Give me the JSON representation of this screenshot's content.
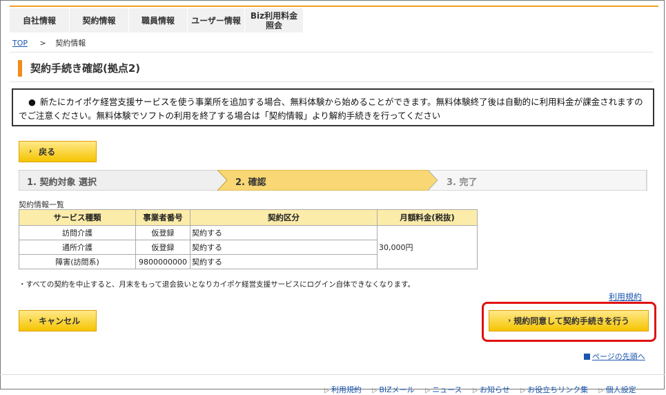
{
  "nav": [
    {
      "label": "自社情報"
    },
    {
      "label": "契約情報"
    },
    {
      "label": "職員情報"
    },
    {
      "label": "ユーザー情報"
    },
    {
      "label": "Biz利用料金\n照会"
    }
  ],
  "breadcrumb": {
    "top": "TOP",
    "separator": ">",
    "current": "契約情報"
  },
  "page_title": "契約手続き確認(拠点2)",
  "notice": "新たにカイポケ経営支援サービスを使う事業所を追加する場合、無料体験から始めることができます。無料体験終了後は自動的に利用料金が課金されますのでご注意ください。無料体験でソフトの利用を終了する場合は「契約情報」より解約手続きを行ってください",
  "back_button": "戻る",
  "steps": [
    {
      "label": "1. 契約対象 選択",
      "state": "done"
    },
    {
      "label": "2. 確認",
      "state": "active"
    },
    {
      "label": "3. 完了",
      "state": "pending"
    }
  ],
  "table": {
    "caption": "契約情報一覧",
    "headers": [
      "サービス種類",
      "事業者番号",
      "契約区分",
      "月額料金(税抜)"
    ],
    "rows": [
      {
        "service": "訪問介護",
        "number": "仮登録",
        "type": "契約する"
      },
      {
        "service": "通所介護",
        "number": "仮登録",
        "type": "契約する"
      },
      {
        "service": "障害(訪問系)",
        "number": "9800000000",
        "type": "契約する"
      }
    ],
    "monthly_fee": "30,000円"
  },
  "note": "・すべての契約を中止すると、月末をもって退会扱いとなりカイポケ経営支援サービスにログイン自体できなくなります。",
  "terms_link": "利用規約",
  "cancel_button": "キャンセル",
  "agree_button": "規約同意して契約手続きを行う",
  "page_top_link": "ページの先頭へ",
  "footer_links": [
    "利用規約",
    "BIZメール",
    "ニュース",
    "お知らせ",
    "お役立ちリンク集",
    "個人設定"
  ],
  "colors": {
    "accent": "#f08c1a",
    "button": "#f5c400",
    "highlight": "#e01010",
    "link": "#1a56b0"
  }
}
